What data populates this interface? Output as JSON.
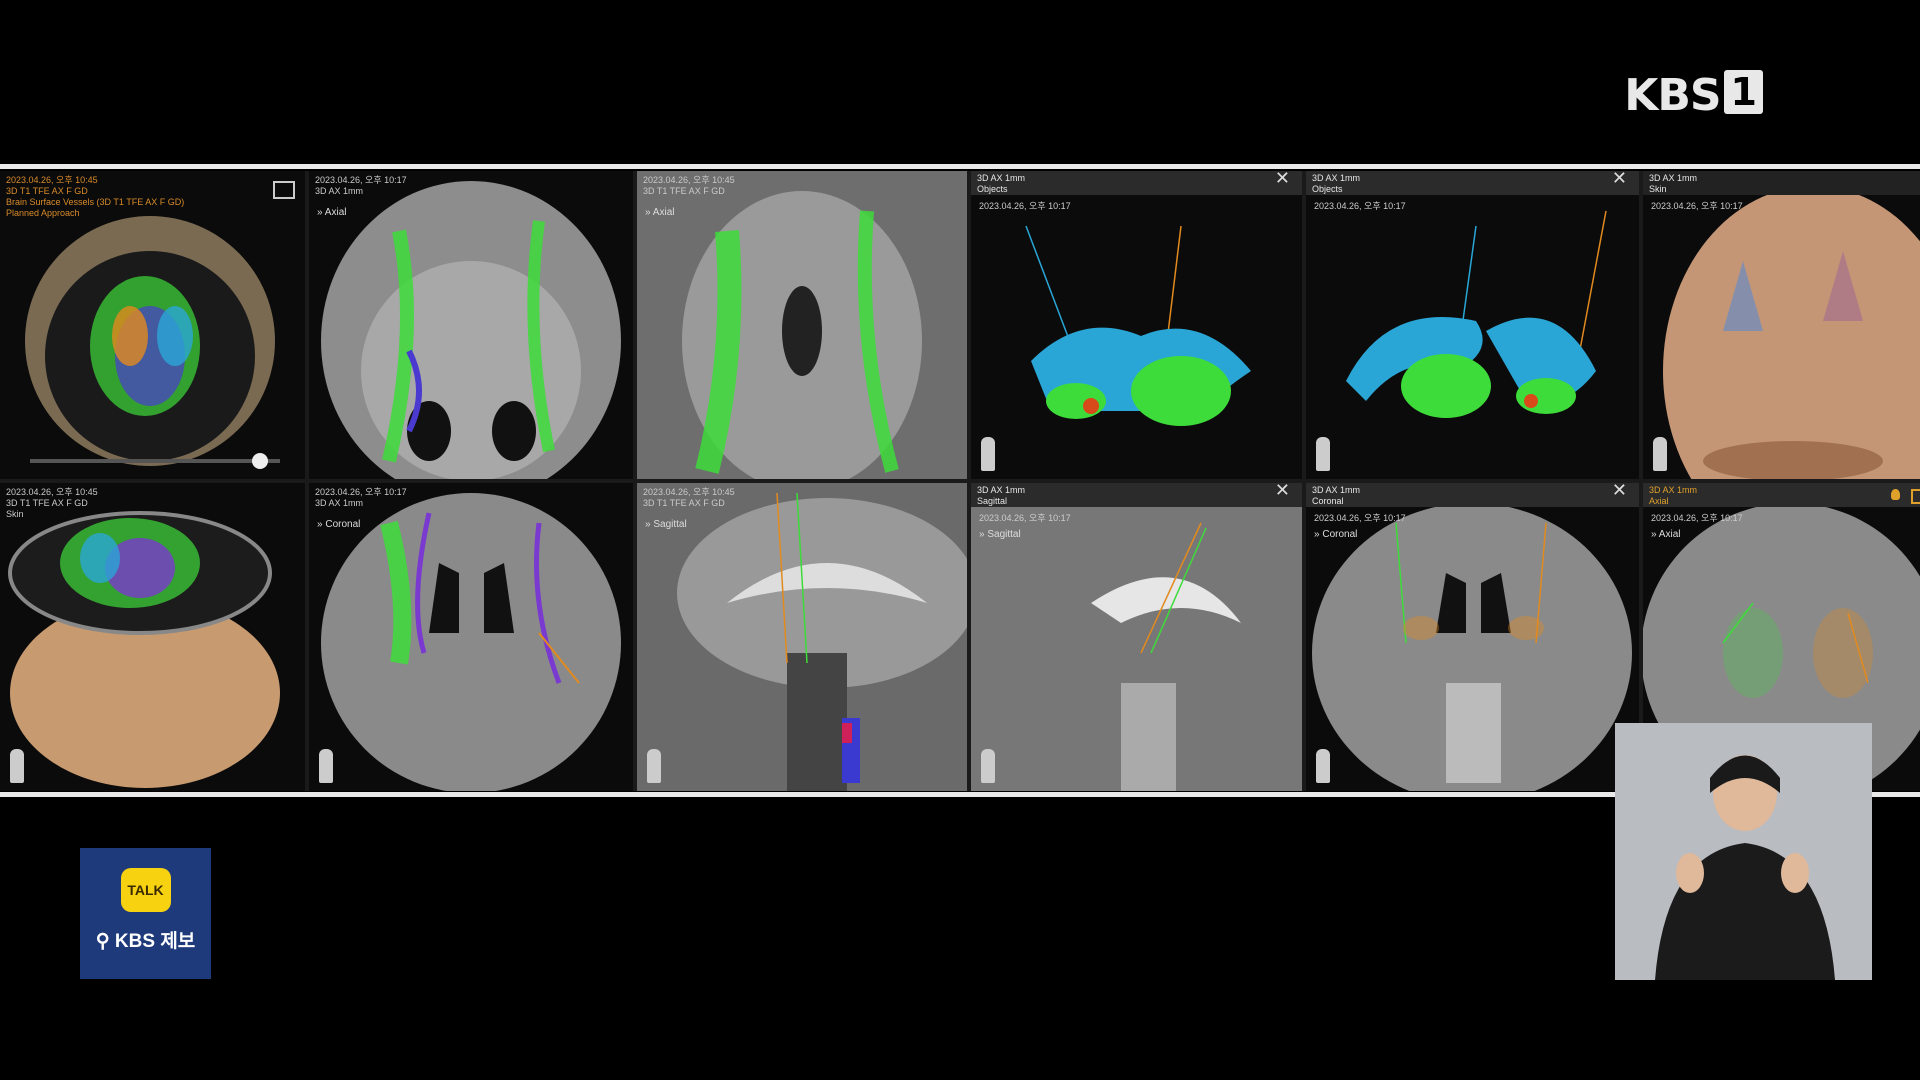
{
  "broadcast": {
    "logo": "KBS",
    "channel": "1"
  },
  "tiles": [
    {
      "lines": "2023.04.26, 오후 10:45\n3D T1 TFE AX F GD\nBrain Surface Vessels (3D T1 TFE AX F GD)\nPlanned Approach"
    },
    {
      "lines": "2023.04.26, 오후 10:17\n3D AX 1mm",
      "mode": "Axial"
    },
    {
      "lines": "2023.04.26, 오후 10:45\n3D T1 TFE AX F GD",
      "mode": "Axial"
    },
    {
      "header": "3D AX 1mm\nObjects",
      "date": "2023.04.26, 오후 10:17"
    },
    {
      "header": "3D AX 1mm\nObjects",
      "date": "2023.04.26, 오후 10:17"
    },
    {
      "header": "3D AX 1mm\nSkin",
      "date": "2023.04.26, 오후 10:17"
    },
    {
      "lines": "2023.04.26, 오후 10:45\n3D T1 TFE AX F GD\nSkin"
    },
    {
      "lines": "2023.04.26, 오후 10:17\n3D AX 1mm",
      "mode": "Coronal"
    },
    {
      "lines": "2023.04.26, 오후 10:45\n3D T1 TFE AX F GD",
      "mode": "Sagittal"
    },
    {
      "header": "3D AX 1mm\nSagittal",
      "date": "2023.04.26, 오후 10:17",
      "mode": "Sagittal"
    },
    {
      "header": "3D AX 1mm\nCoronal",
      "date": "2023.04.26, 오후 10:17",
      "mode": "Coronal"
    },
    {
      "header": "3D AX 1mm\nAxial",
      "date": "2023.04.26, 오후 10:17",
      "mode": "Axial"
    }
  ],
  "kakao": {
    "bubble": "TALK",
    "label": "KBS 제보"
  },
  "colors": {
    "fiber_green": "#3ddc3a",
    "structure_blue": "#2aa6d6",
    "trajectory_orange": "#e28a1e"
  }
}
